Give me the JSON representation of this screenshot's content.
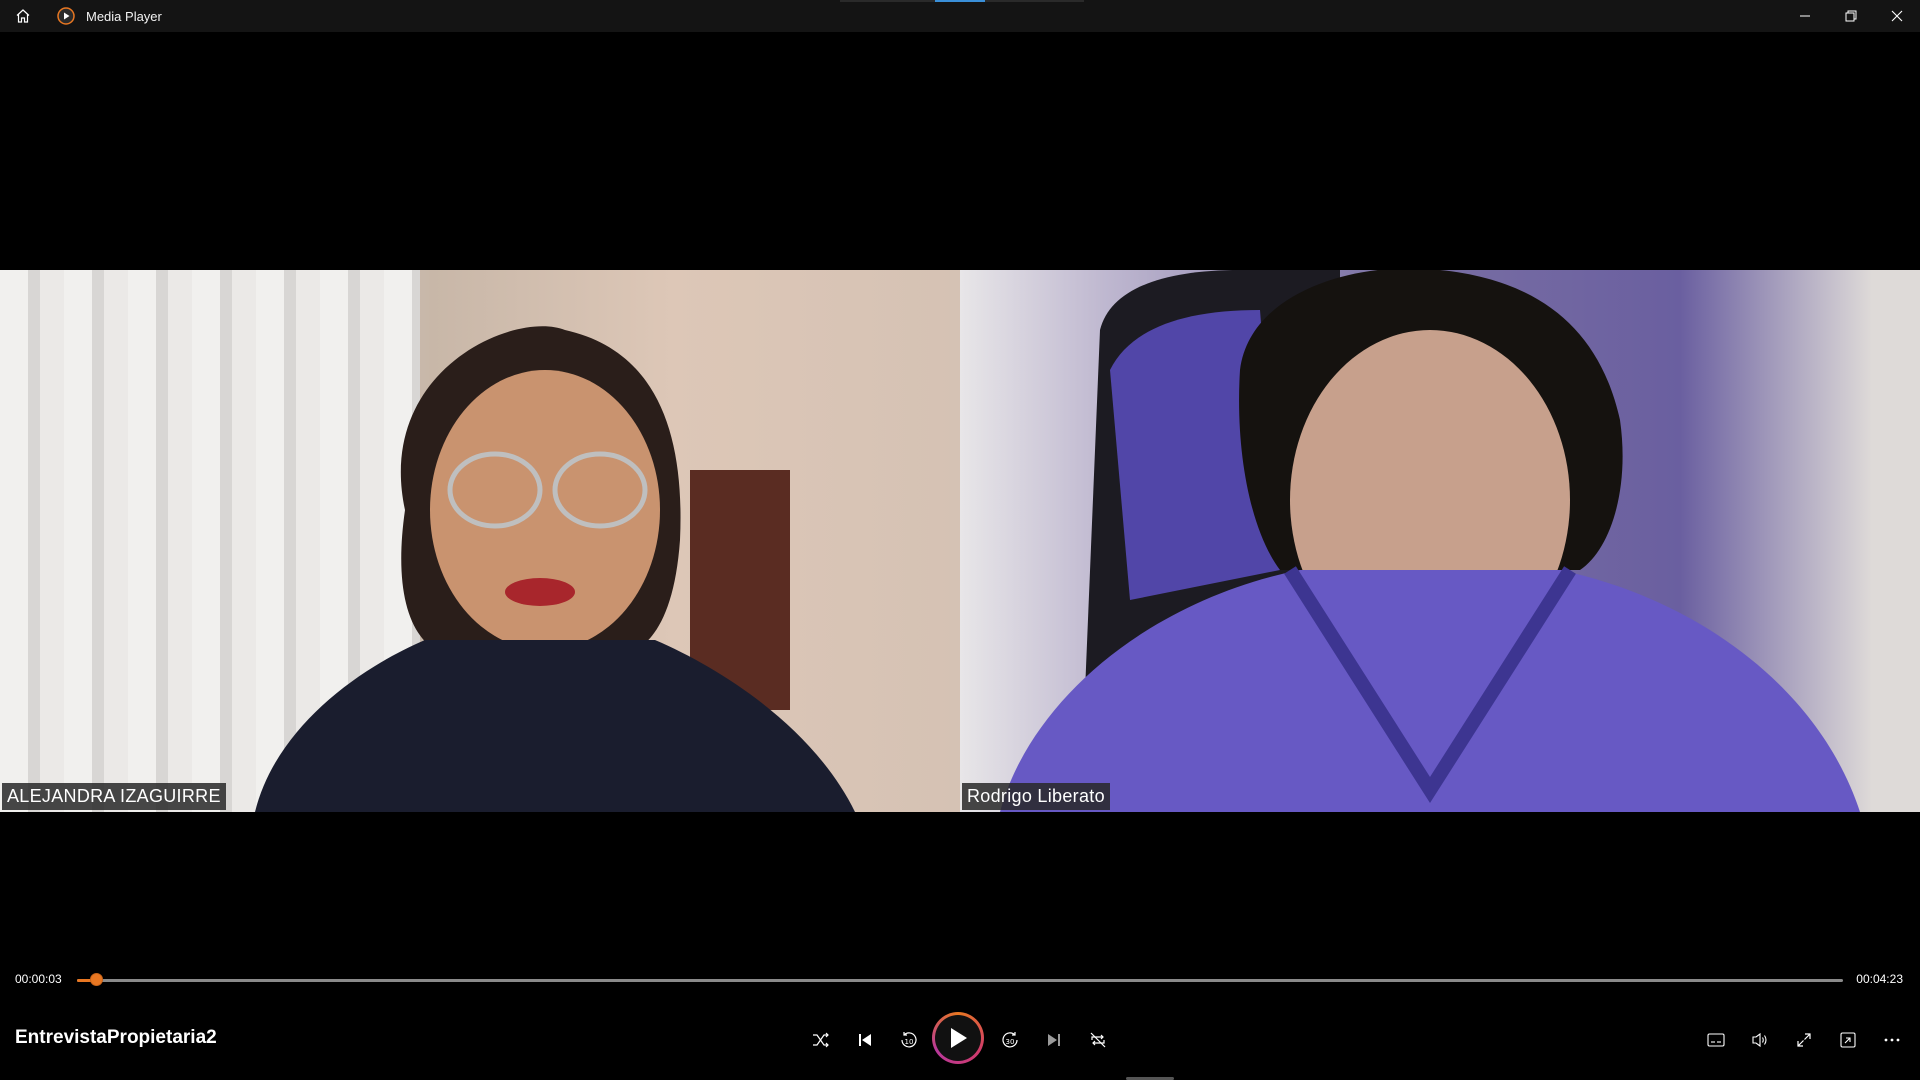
{
  "window": {
    "title": "Media Player"
  },
  "video": {
    "participants": [
      {
        "name": "ALEJANDRA IZAGUIRRE"
      },
      {
        "name": "Rodrigo Liberato"
      }
    ]
  },
  "playback": {
    "current_time": "00:00:03",
    "total_time": "00:04:23",
    "progress_fraction": 0.0114,
    "media_title": "EntrevistaPropietaria2"
  },
  "colors": {
    "accent": "#e87722",
    "play_ring_start": "#e87722",
    "play_ring_end": "#d13b6b",
    "background": "#000000",
    "titlebar": "#141414"
  },
  "icons": {
    "titlebar": [
      "home-icon",
      "media-player-app-icon",
      "minimize-icon",
      "restore-icon",
      "close-icon"
    ],
    "transport": [
      "shuffle-icon",
      "previous-icon",
      "skip-back-10-icon",
      "play-icon",
      "skip-forward-30-icon",
      "next-icon",
      "repeat-off-icon"
    ],
    "right": [
      "captions-icon",
      "volume-icon",
      "fullscreen-icon",
      "miniplayer-icon",
      "more-icon"
    ]
  }
}
